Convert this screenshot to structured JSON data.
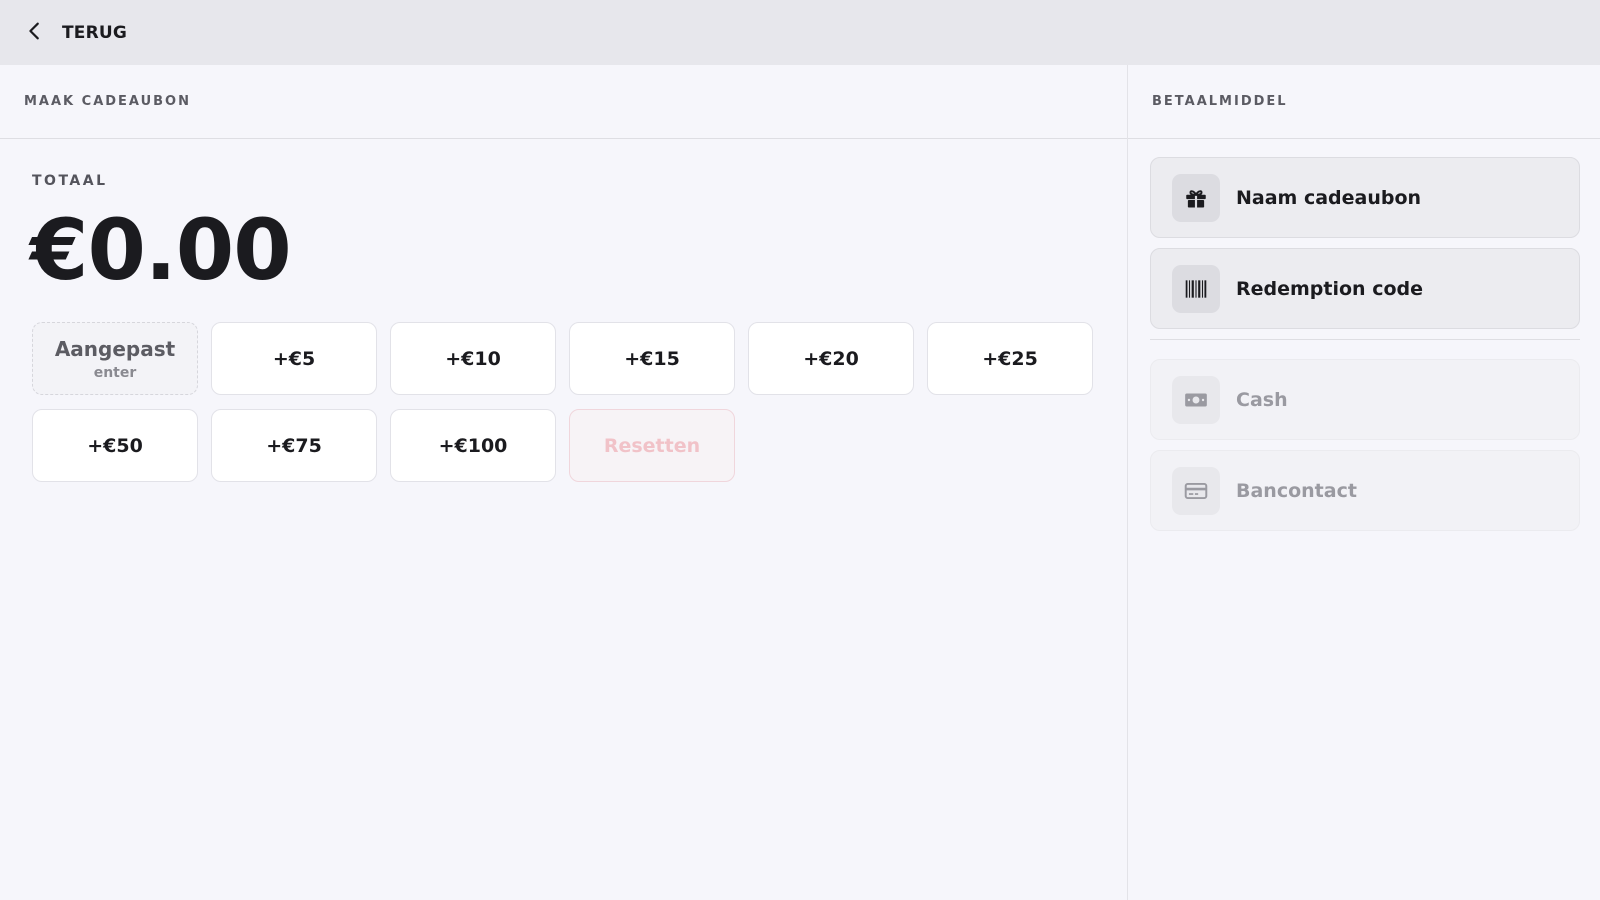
{
  "header": {
    "back_label": "TERUG"
  },
  "left_panel": {
    "title": "MAAK CADEAUBON",
    "total_label": "TOTAAL",
    "total_value": "€0.00",
    "custom": {
      "title": "Aangepast",
      "subtitle": "enter"
    },
    "amounts": [
      "+€5",
      "+€10",
      "+€15",
      "+€20",
      "+€25",
      "+€50",
      "+€75",
      "+€100"
    ],
    "reset_label": "Resetten"
  },
  "right_panel": {
    "title": "BETAALMIDDEL",
    "methods": [
      {
        "label": "Naam cadeaubon",
        "icon": "gift-icon",
        "enabled": true
      },
      {
        "label": "Redemption code",
        "icon": "barcode-icon",
        "enabled": true
      },
      {
        "label": "Cash",
        "icon": "cash-icon",
        "enabled": false
      },
      {
        "label": "Bancontact",
        "icon": "card-icon",
        "enabled": false
      }
    ]
  }
}
